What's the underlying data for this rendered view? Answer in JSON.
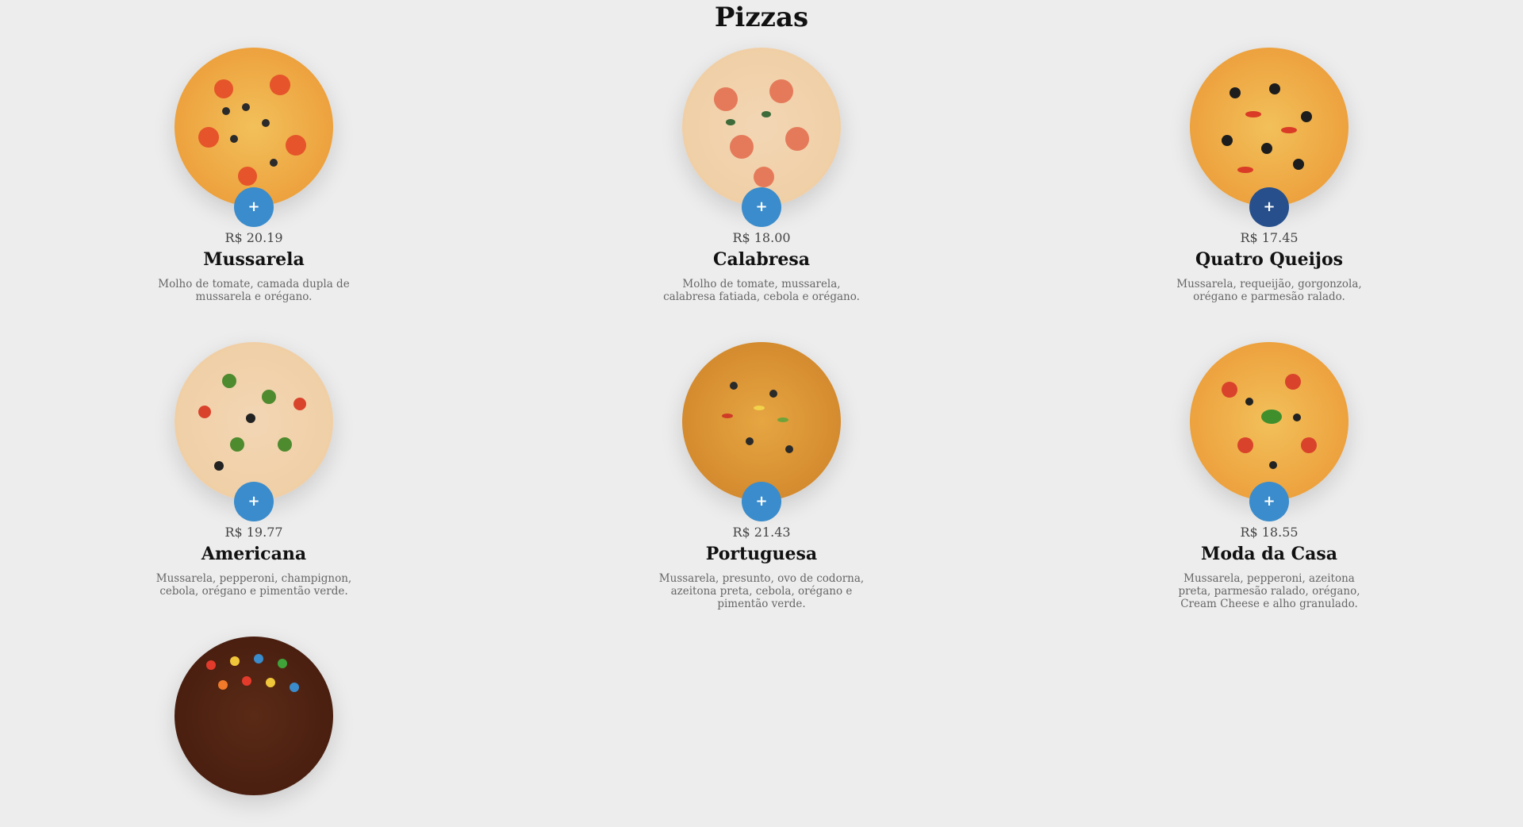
{
  "page": {
    "title": "Pizzas"
  },
  "add_button_label": "+",
  "pizzas": [
    {
      "price": "R$ 20.19",
      "name": "Mussarela",
      "description": "Molho de tomate, camada dupla de mussarela e orégano.",
      "image": "mussarela-pizza-image",
      "button_state": "default"
    },
    {
      "price": "R$ 18.00",
      "name": "Calabresa",
      "description": "Molho de tomate, mussarela, calabresa fatiada, cebola e orégano.",
      "image": "calabresa-pizza-image",
      "button_state": "default"
    },
    {
      "price": "R$ 17.45",
      "name": "Quatro Queijos",
      "description": "Mussarela, requeijão, gorgonzola, orégano e parmesão ralado.",
      "image": "quatro-queijos-pizza-image",
      "button_state": "hover"
    },
    {
      "price": "R$ 19.77",
      "name": "Americana",
      "description": "Mussarela, pepperoni, champignon, cebola, orégano e pimentão verde.",
      "image": "americana-pizza-image",
      "button_state": "default"
    },
    {
      "price": "R$ 21.43",
      "name": "Portuguesa",
      "description": "Mussarela, presunto, ovo de codorna, azeitona preta, cebola, orégano e pimentão verde.",
      "image": "portuguesa-pizza-image",
      "button_state": "default"
    },
    {
      "price": "R$ 18.55",
      "name": "Moda da Casa",
      "description": "Mussarela, pepperoni, azeitona preta, parmesão ralado, orégano, Cream Cheese e alho granulado.",
      "image": "moda-da-casa-pizza-image",
      "button_state": "default"
    },
    {
      "image": "chocolate-pizza-image"
    }
  ],
  "colors": {
    "background": "#ededed",
    "button": "#3a8ccc",
    "button_hover": "#264f8c",
    "title": "#111111",
    "description": "#666666"
  }
}
